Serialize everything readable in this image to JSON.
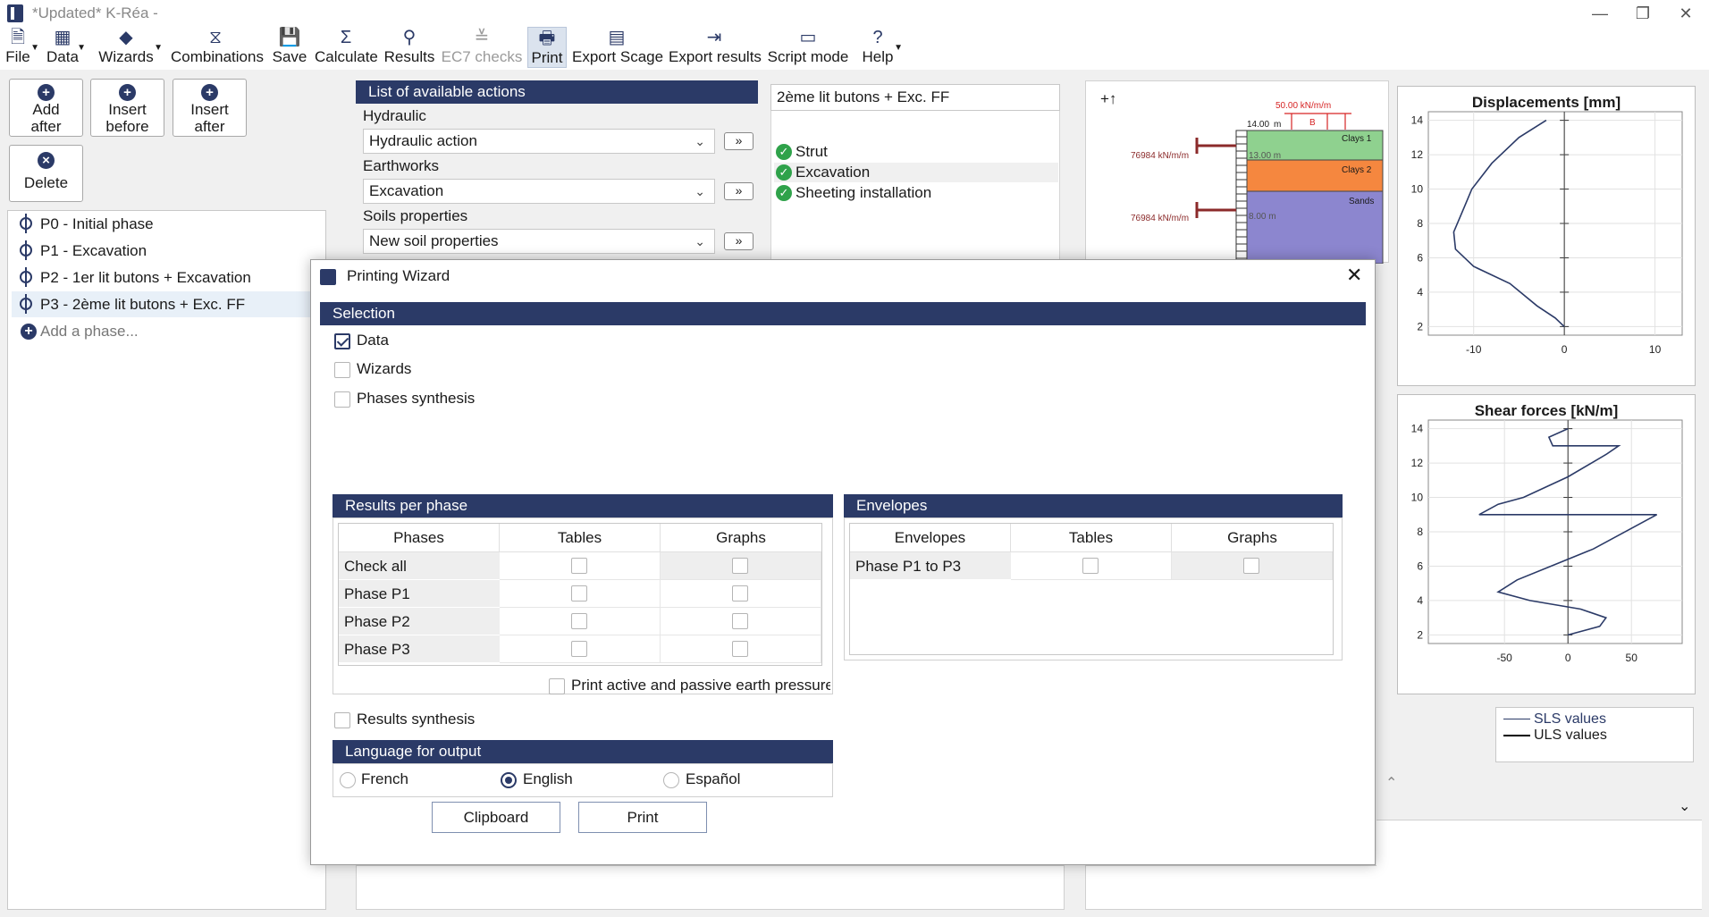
{
  "window": {
    "title": "*Updated* K-Réa -"
  },
  "ribbon": {
    "items": [
      {
        "label": "File",
        "icon": "file-icon"
      },
      {
        "label": "Data",
        "icon": "data-icon"
      },
      {
        "label": "Wizards",
        "icon": "wizard-icon"
      },
      {
        "label": "Combinations",
        "icon": "combinations-icon"
      },
      {
        "label": "Save",
        "icon": "save-icon"
      },
      {
        "label": "Calculate",
        "icon": "sigma-icon"
      },
      {
        "label": "Results",
        "icon": "results-icon"
      },
      {
        "label": "EC7 checks",
        "icon": "check-icon"
      },
      {
        "label": "Print",
        "icon": "printer-icon"
      },
      {
        "label": "Export Scage",
        "icon": "film-icon"
      },
      {
        "label": "Export results",
        "icon": "export-icon"
      },
      {
        "label": "Script mode",
        "icon": "script-icon"
      },
      {
        "label": "Help",
        "icon": "help-icon"
      }
    ]
  },
  "phase_buttons": {
    "add_after": "Add\nafter",
    "insert_before": "Insert\nbefore",
    "insert_after": "Insert\nafter",
    "delete": "Delete"
  },
  "phases": [
    "P0 - Initial phase",
    "P1 - Excavation",
    "P2 - 1er lit butons + Excavation",
    "P3 - 2ème lit butons + Exc. FF"
  ],
  "add_phase": "Add a phase...",
  "actions": {
    "header": "List of available actions",
    "groups": [
      {
        "label": "Hydraulic",
        "value": "Hydraulic action"
      },
      {
        "label": "Earthworks",
        "value": "Excavation"
      },
      {
        "label": "Soils properties",
        "value": "New soil properties"
      }
    ],
    "add_symbol": "»"
  },
  "phase_detail": {
    "name": "2ème lit butons + Exc. FF",
    "stages": [
      "Strut",
      "Excavation",
      "Sheeting installation"
    ]
  },
  "section_view": {
    "load": "50.00 kN/m/m",
    "load_marker": "B",
    "top_level": "14.00",
    "top_unit": "m",
    "level2": "13.00 m",
    "level3": "8.00 m",
    "strut_stiffness_1": "76984 kN/m/m",
    "strut_stiffness_2": "76984 kN/m/m",
    "layers": [
      {
        "name": "Clays 1",
        "color": "#8fd18f"
      },
      {
        "name": "Clays 2",
        "color": "#f5873f"
      },
      {
        "name": "Sands",
        "color": "#8c86cf"
      }
    ],
    "axis_icon": "+↑"
  },
  "chart_data": [
    {
      "type": "line",
      "title": "Displacements [mm]",
      "xlabel": "",
      "ylabel": "",
      "xlim": [
        -15,
        13
      ],
      "ylim": [
        1.5,
        14.5
      ],
      "xticks": [
        -10,
        0,
        10
      ],
      "yticks": [
        2,
        4,
        6,
        8,
        10,
        12,
        14
      ],
      "series": [
        {
          "name": "SLS values",
          "points": [
            [
              -2,
              14
            ],
            [
              -5,
              13
            ],
            [
              -8,
              11.5
            ],
            [
              -10.2,
              10
            ],
            [
              -11,
              9
            ],
            [
              -12.2,
              7.5
            ],
            [
              -12,
              6.5
            ],
            [
              -10,
              5.5
            ],
            [
              -6,
              4.5
            ],
            [
              -3,
              3.2
            ],
            [
              -1,
              2.5
            ],
            [
              0,
              2
            ]
          ]
        }
      ]
    },
    {
      "type": "line",
      "title": "Shear forces [kN/m]",
      "xlabel": "",
      "ylabel": "",
      "xlim": [
        -110,
        90
      ],
      "ylim": [
        1.5,
        14.5
      ],
      "xticks": [
        -50,
        0,
        50
      ],
      "yticks": [
        2,
        4,
        6,
        8,
        10,
        12,
        14
      ],
      "series": [
        {
          "name": "SLS values",
          "points": [
            [
              0,
              14
            ],
            [
              -15,
              13.5
            ],
            [
              -12,
              13
            ],
            [
              40,
              13
            ],
            [
              30,
              12.5
            ],
            [
              0,
              11.2
            ],
            [
              -35,
              10
            ],
            [
              -55,
              9.6
            ],
            [
              -70,
              9
            ],
            [
              70,
              9
            ],
            [
              20,
              7
            ],
            [
              -40,
              5.2
            ],
            [
              -55,
              4.5
            ],
            [
              -30,
              4
            ],
            [
              10,
              3.5
            ],
            [
              30,
              3
            ],
            [
              25,
              2.5
            ],
            [
              0,
              2
            ]
          ]
        }
      ]
    }
  ],
  "legend": [
    "SLS values",
    "ULS values"
  ],
  "dialog": {
    "title": "Printing Wizard",
    "selection": {
      "header": "Selection",
      "options": [
        {
          "label": "Data",
          "checked": true
        },
        {
          "label": "Wizards",
          "checked": false
        },
        {
          "label": "Phases synthesis",
          "checked": false
        }
      ]
    },
    "results_per_phase": {
      "header": "Results per phase",
      "columns": [
        "Phases",
        "Tables",
        "Graphs"
      ],
      "rows": [
        "Check all",
        "Phase P1",
        "Phase P2",
        "Phase P3"
      ],
      "earth_pressures": "Print active and passive earth pressures"
    },
    "envelopes": {
      "header": "Envelopes",
      "columns": [
        "Envelopes",
        "Tables",
        "Graphs"
      ],
      "rows": [
        "Phase P1 to P3"
      ]
    },
    "results_synthesis": "Results synthesis",
    "language": {
      "header": "Language for output",
      "options": [
        "French",
        "English",
        "Español"
      ],
      "selected": "English"
    },
    "buttons": {
      "clipboard": "Clipboard",
      "print": "Print"
    }
  },
  "colors": {
    "accent": "#2b3a67",
    "ok": "#2fa24a",
    "load_red": "#d62424",
    "strut": "#8b2a2a"
  }
}
